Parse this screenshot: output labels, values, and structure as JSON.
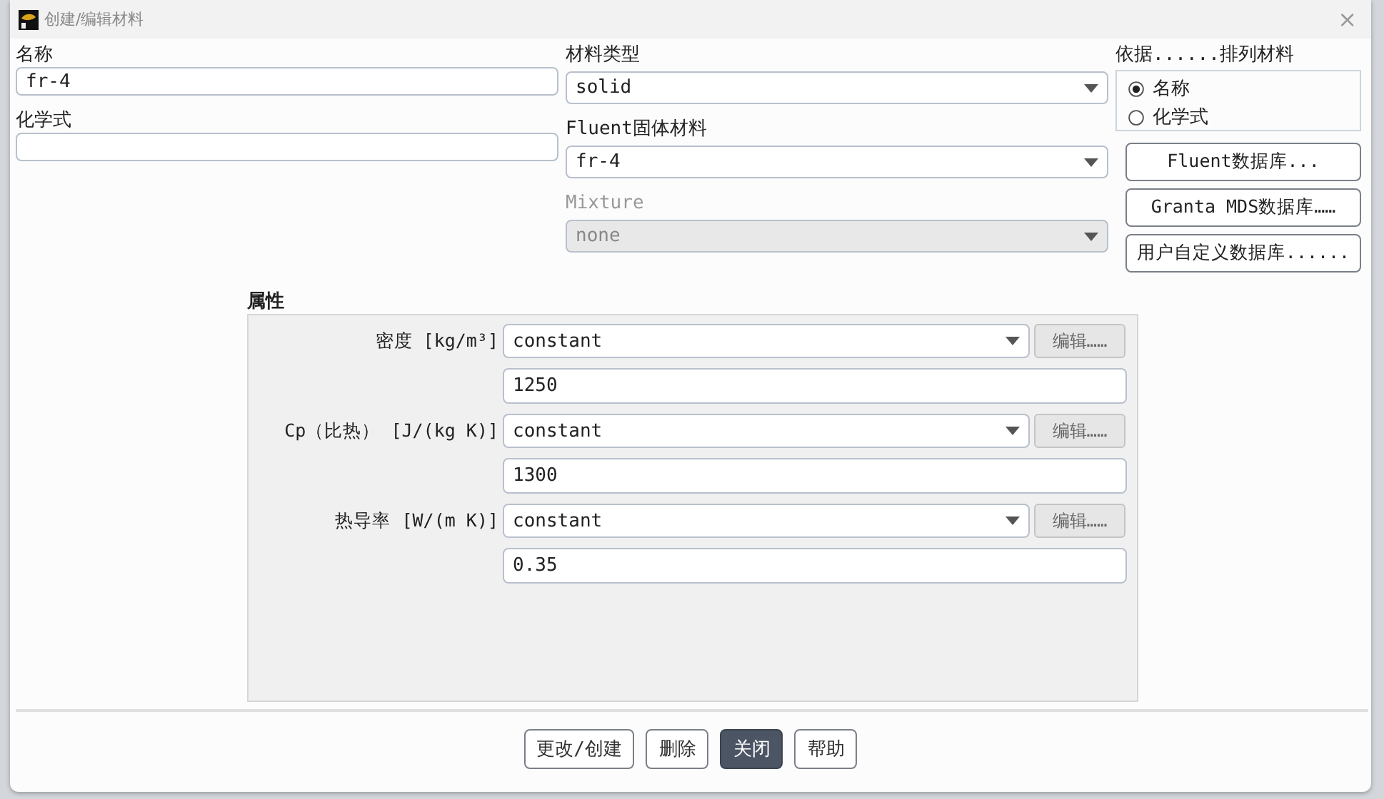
{
  "window": {
    "title": "创建/编辑材料",
    "close": "×"
  },
  "name": {
    "label": "名称",
    "value": "fr-4"
  },
  "chemical_formula": {
    "label": "化学式"
  },
  "material_type": {
    "label": "材料类型",
    "value": "solid",
    "disabled": false
  },
  "fluent_material": {
    "label": "Fluent固体材料",
    "value": "fr-4",
    "disabled": false
  },
  "mixture": {
    "label": "Mixture",
    "value": "none",
    "disabled": true
  },
  "order_by": {
    "label": "依据......排列材料",
    "options": [
      {
        "label": "名称",
        "selected": true
      },
      {
        "label": "化学式",
        "selected": false
      }
    ]
  },
  "database_buttons": [
    "Fluent数据库...",
    "Granta MDS数据库……",
    "用户自定义数据库......"
  ],
  "properties": {
    "title": "属性",
    "rows": [
      {
        "label": "密度 [kg/m³]",
        "method": "constant",
        "value": "1250",
        "edit": "编辑……"
      },
      {
        "label": "Cp（比热） [J/(kg K)]",
        "method": "constant",
        "value": "1300",
        "edit": "编辑……"
      },
      {
        "label": "热导率 [W/(m K)]",
        "method": "constant",
        "value": "0.35",
        "edit": "编辑……"
      }
    ]
  },
  "buttons": [
    {
      "label": "更改/创建",
      "primary": false
    },
    {
      "label": "删除",
      "primary": false
    },
    {
      "label": "关闭",
      "primary": true
    },
    {
      "label": "帮助",
      "primary": false
    }
  ]
}
